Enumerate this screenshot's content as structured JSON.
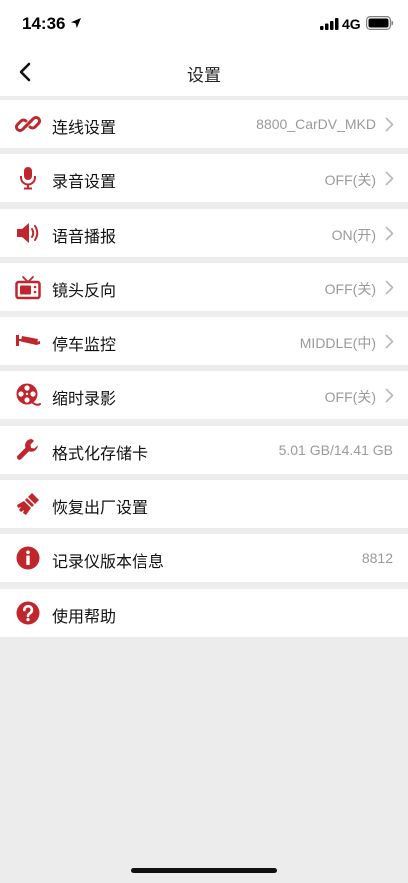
{
  "status_bar": {
    "time": "14:36",
    "network": "4G",
    "icons": [
      "location-arrow-icon",
      "signal-bars-icon",
      "battery-icon"
    ]
  },
  "nav": {
    "title": "设置",
    "back_icon": "chevron-left-icon"
  },
  "accent_color": "#c0272d",
  "settings": [
    {
      "label": "连线设置",
      "value": "8800_CarDV_MKD",
      "icon": "link-icon",
      "chevron": true
    },
    {
      "label": "录音设置",
      "value": "OFF(关)",
      "icon": "microphone-icon",
      "chevron": true
    },
    {
      "label": "语音播报",
      "value": "ON(开)",
      "icon": "speaker-icon",
      "chevron": true
    },
    {
      "label": "镜头反向",
      "value": "OFF(关)",
      "icon": "tv-icon",
      "chevron": true
    },
    {
      "label": "停车监控",
      "value": "MIDDLE(中)",
      "icon": "cctv-camera-icon",
      "chevron": true
    },
    {
      "label": "缩时录影",
      "value": "OFF(关)",
      "icon": "film-reel-icon",
      "chevron": true
    },
    {
      "label": "格式化存储卡",
      "value": "5.01 GB/14.41 GB",
      "icon": "wrench-icon",
      "chevron": false
    },
    {
      "label": "恢复出厂设置",
      "value": "",
      "icon": "brush-icon",
      "chevron": false
    },
    {
      "label": "记录仪版本信息",
      "value": "8812",
      "icon": "info-icon",
      "chevron": false
    },
    {
      "label": "使用帮助",
      "value": "",
      "icon": "help-icon",
      "chevron": false
    }
  ]
}
